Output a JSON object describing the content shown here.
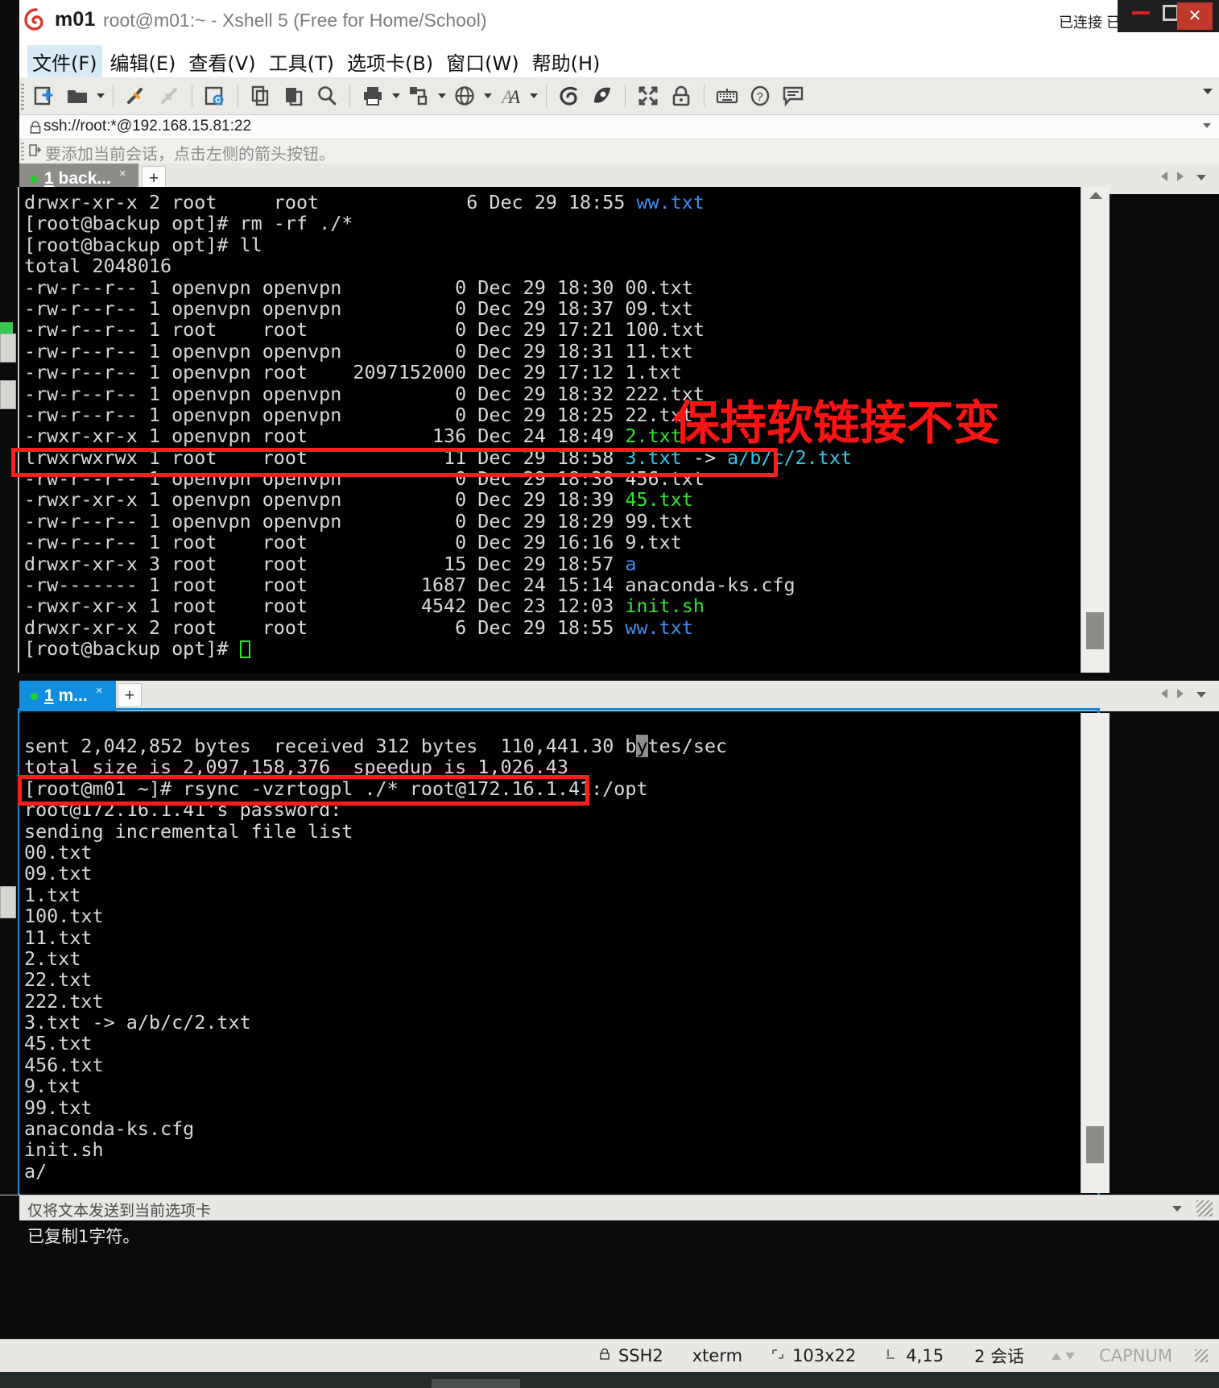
{
  "window": {
    "app_short_name": "m01",
    "title": "root@m01:~ - Xshell 5 (Free for Home/School)",
    "connection_status": "已连接 已连接",
    "close_glyph": "✕"
  },
  "menubar": {
    "items": [
      {
        "label": "文件(F)",
        "highlighted": true
      },
      {
        "label": "编辑(E)",
        "highlighted": false
      },
      {
        "label": "查看(V)",
        "highlighted": false
      },
      {
        "label": "工具(T)",
        "highlighted": false
      },
      {
        "label": "选项卡(B)",
        "highlighted": false
      },
      {
        "label": "窗口(W)",
        "highlighted": false
      },
      {
        "label": "帮助(H)",
        "highlighted": false
      }
    ]
  },
  "toolbar": {
    "icons": [
      "new-session-icon",
      "open-folder-icon",
      "open-folder-dropdown",
      "connect-icon",
      "disconnect-icon",
      "properties-icon",
      "copy-session-icon",
      "paste-icon",
      "find-icon",
      "print-icon",
      "print-dropdown",
      "transfer-icon",
      "transfer-dropdown",
      "globe-icon",
      "globe-dropdown",
      "font-icon",
      "font-dropdown",
      "xshell-icon",
      "xftp-icon",
      "fullscreen-icon",
      "lock-icon",
      "keyboard-icon",
      "help-icon",
      "comment-icon"
    ],
    "overflow": "toolbar-overflow-caret"
  },
  "address_bar": {
    "value": "ssh://root:*@192.168.15.81:22",
    "lock_icon": "lock-icon"
  },
  "hint_bar": {
    "text": "要添加当前会话，点击左侧的箭头按钮。",
    "icon": "add-session-icon"
  },
  "pane_top": {
    "tab": {
      "label_prefix": "1",
      "label_rest": " back...",
      "close": "×",
      "active": false
    },
    "new_tab": "+",
    "lines": [
      [
        {
          "t": "drwxr-xr-x 2 root     root             6 Dec 29 18:55 ",
          "c": "w"
        },
        {
          "t": "ww.txt",
          "c": "b"
        }
      ],
      [
        {
          "t": "[root@backup opt]# rm -rf ./*",
          "c": "w"
        }
      ],
      [
        {
          "t": "[root@backup opt]# ll",
          "c": "w"
        }
      ],
      [
        {
          "t": "total 2048016",
          "c": "w"
        }
      ],
      [
        {
          "t": "-rw-r--r-- 1 openvpn openvpn          0 Dec 29 18:30 00.txt",
          "c": "w"
        }
      ],
      [
        {
          "t": "-rw-r--r-- 1 openvpn openvpn          0 Dec 29 18:37 09.txt",
          "c": "w"
        }
      ],
      [
        {
          "t": "-rw-r--r-- 1 root    root             0 Dec 29 17:21 100.txt",
          "c": "w"
        }
      ],
      [
        {
          "t": "-rw-r--r-- 1 openvpn openvpn          0 Dec 29 18:31 11.txt",
          "c": "w"
        }
      ],
      [
        {
          "t": "-rw-r--r-- 1 openvpn root    2097152000 Dec 29 17:12 1.txt",
          "c": "w"
        }
      ],
      [
        {
          "t": "-rw-r--r-- 1 openvpn openvpn          0 Dec 29 18:32 222.txt",
          "c": "w"
        }
      ],
      [
        {
          "t": "-rw-r--r-- 1 openvpn openvpn          0 Dec 29 18:25 22.txt",
          "c": "w"
        }
      ],
      [
        {
          "t": "-rwxr-xr-x 1 openvpn root           136 Dec 24 18:49 ",
          "c": "w"
        },
        {
          "t": "2.txt",
          "c": "g"
        }
      ],
      [
        {
          "t": "lrwxrwxrwx 1 root    root            11 Dec 29 18:58 ",
          "c": "w"
        },
        {
          "t": "3.txt",
          "c": "c"
        },
        {
          "t": " -> ",
          "c": "w"
        },
        {
          "t": "a/b/c/2.txt",
          "c": "c"
        }
      ],
      [
        {
          "t": "-rw-r--r-- 1 openvpn openvpn          0 Dec 29 18:38 456.txt",
          "c": "w"
        }
      ],
      [
        {
          "t": "-rwxr-xr-x 1 openvpn openvpn          0 Dec 29 18:39 ",
          "c": "w"
        },
        {
          "t": "45.txt",
          "c": "g"
        }
      ],
      [
        {
          "t": "-rw-r--r-- 1 openvpn openvpn          0 Dec 29 18:29 99.txt",
          "c": "w"
        }
      ],
      [
        {
          "t": "-rw-r--r-- 1 root    root             0 Dec 29 16:16 9.txt",
          "c": "w"
        }
      ],
      [
        {
          "t": "drwxr-xr-x 3 root    root            15 Dec 29 18:57 ",
          "c": "w"
        },
        {
          "t": "a",
          "c": "b"
        }
      ],
      [
        {
          "t": "-rw------- 1 root    root          1687 Dec 24 15:14 anaconda-ks.cfg",
          "c": "w"
        }
      ],
      [
        {
          "t": "-rwxr-xr-x 1 root    root          4542 Dec 23 12:03 ",
          "c": "w"
        },
        {
          "t": "init.sh",
          "c": "g"
        }
      ],
      [
        {
          "t": "drwxr-xr-x 2 root    root             6 Dec 29 18:55 ",
          "c": "w"
        },
        {
          "t": "ww.txt",
          "c": "b"
        }
      ],
      [
        {
          "t": "[root@backup opt]# ",
          "c": "w"
        },
        {
          "t": "",
          "c": "cursor"
        }
      ]
    ]
  },
  "pane_bottom": {
    "tab": {
      "label_prefix": "1",
      "label_rest": " m...",
      "close": "×",
      "active": true
    },
    "new_tab": "+",
    "lines": [
      [
        {
          "t": "sent 2,042,852 bytes  received 312 bytes  110,441.30 b",
          "c": "w"
        },
        {
          "t": "y",
          "c": "sel"
        },
        {
          "t": "tes/sec",
          "c": "w"
        }
      ],
      [
        {
          "t": "total size is 2,097,158,376  speedup is 1,026.43",
          "c": "w"
        }
      ],
      [
        {
          "t": "[root@m01 ~]# rsync -vzrtogpl ./* root@172.16.1.41:/opt",
          "c": "w"
        }
      ],
      [
        {
          "t": "root@172.16.1.41's password:",
          "c": "w"
        }
      ],
      [
        {
          "t": "sending incremental file list",
          "c": "w"
        }
      ],
      [
        {
          "t": "00.txt",
          "c": "w"
        }
      ],
      [
        {
          "t": "09.txt",
          "c": "w"
        }
      ],
      [
        {
          "t": "1.txt",
          "c": "w"
        }
      ],
      [
        {
          "t": "100.txt",
          "c": "w"
        }
      ],
      [
        {
          "t": "11.txt",
          "c": "w"
        }
      ],
      [
        {
          "t": "2.txt",
          "c": "w"
        }
      ],
      [
        {
          "t": "22.txt",
          "c": "w"
        }
      ],
      [
        {
          "t": "222.txt",
          "c": "w"
        }
      ],
      [
        {
          "t": "3.txt -> a/b/c/2.txt",
          "c": "w"
        }
      ],
      [
        {
          "t": "45.txt",
          "c": "w"
        }
      ],
      [
        {
          "t": "456.txt",
          "c": "w"
        }
      ],
      [
        {
          "t": "9.txt",
          "c": "w"
        }
      ],
      [
        {
          "t": "99.txt",
          "c": "w"
        }
      ],
      [
        {
          "t": "anaconda-ks.cfg",
          "c": "w"
        }
      ],
      [
        {
          "t": "init.sh",
          "c": "w"
        }
      ],
      [
        {
          "t": "a/",
          "c": "w"
        }
      ]
    ]
  },
  "annotations": {
    "note_text": "保持软链接不变",
    "note_color": "#ff1212",
    "box_color": "#ff1d1d",
    "boxes": [
      "symlink-line-highlight",
      "rsync-command-highlight"
    ]
  },
  "command_bar": {
    "text": "仅将文本发送到当前选项卡"
  },
  "copy_status": {
    "text": "已复制1字符。"
  },
  "status_bar": {
    "protocol": "SSH2",
    "terminal_type": "xterm",
    "size": "103x22",
    "cursor_pos": "4,15",
    "sessions": "2 会话",
    "indicators": "CAPNUM",
    "lock_icon": "lock-icon",
    "size_icon": "terminal-size-icon",
    "cursor_icon": "cursor-pos-icon"
  }
}
